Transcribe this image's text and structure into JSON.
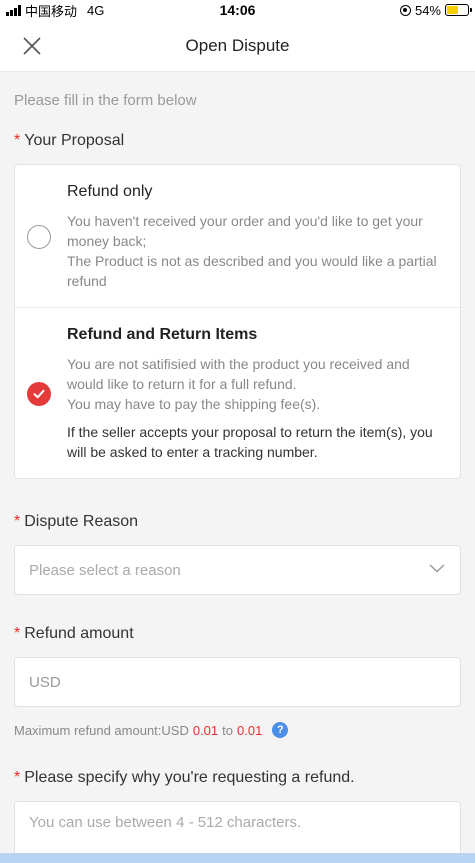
{
  "status_bar": {
    "carrier": "中国移动",
    "network": "4G",
    "time": "14:06",
    "battery_percent": "54%",
    "battery_level": 0.54
  },
  "nav": {
    "title": "Open Dispute",
    "close_icon": "close-icon"
  },
  "form": {
    "hint": "Please fill in the form below",
    "required_mark": "*",
    "proposal": {
      "label": "Your Proposal",
      "options": [
        {
          "title": "Refund only",
          "desc_lines": [
            "You haven't received your order and you'd like to get your money back;",
            "The Product is not as described and you would like a partial refund"
          ],
          "selected": false
        },
        {
          "title": "Refund and Return Items",
          "desc_lines": [
            "You are not satifisied with the product you received and would like to return it for a full refund.",
            "You may have to pay the shipping fee(s)."
          ],
          "note": "If the seller accepts your proposal to return the item(s), you will be asked to enter a tracking number.",
          "selected": true
        }
      ]
    },
    "dispute_reason": {
      "label": "Dispute Reason",
      "placeholder": "Please select a reason"
    },
    "refund_amount": {
      "label": "Refund amount",
      "placeholder": "USD",
      "max_prefix": "Maximum refund amount:USD",
      "min_value": "0.01",
      "to_word": "to",
      "max_value": "0.01"
    },
    "refund_reason": {
      "label": "Please specify why you're requesting a refund.",
      "placeholder": "You can use between 4 - 512 characters."
    }
  },
  "colors": {
    "accent_red": "#e43a3a",
    "help_blue": "#4a8ee8",
    "battery_yellow": "#f5d000"
  }
}
